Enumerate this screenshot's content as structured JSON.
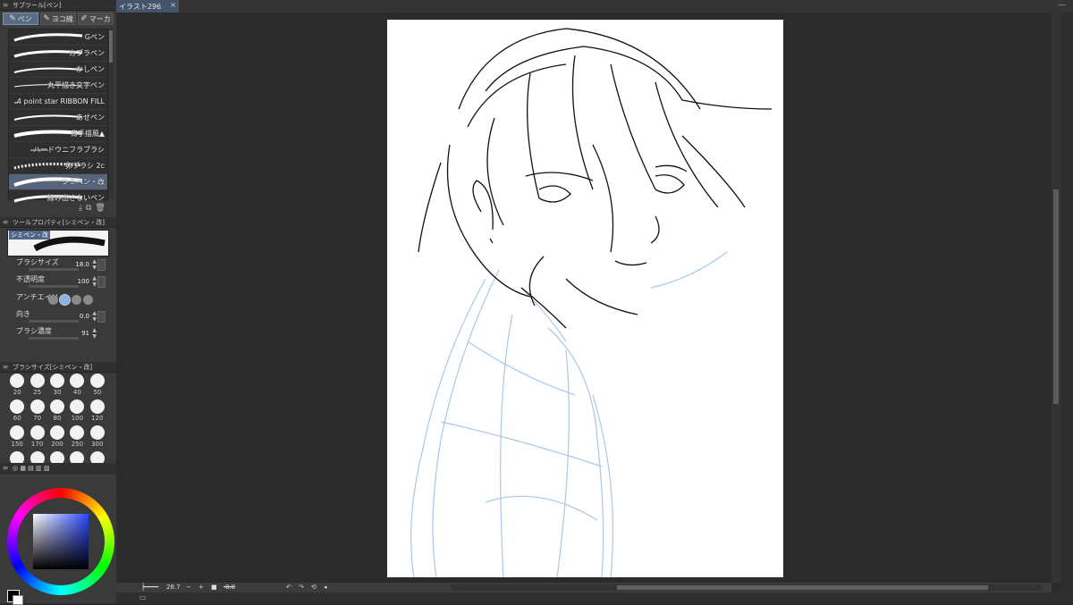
{
  "document": {
    "tab_title": "イラスト296",
    "close_glyph": "×"
  },
  "subtool_panel": {
    "title": "サブツール[ペン]",
    "tabs": [
      {
        "label": "ペン",
        "active": true
      },
      {
        "label": "ヨコ線",
        "active": false
      },
      {
        "label": "マーカ",
        "active": false
      }
    ],
    "brushes": [
      {
        "label": "Gペン",
        "selected": false
      },
      {
        "label": "カブラペン",
        "selected": false
      },
      {
        "label": "かしペン",
        "selected": false
      },
      {
        "label": "丸平描き文字ペン",
        "selected": false
      },
      {
        "label": "4 point star RIBBON FILL",
        "selected": false
      },
      {
        "label": "あせペン",
        "selected": false
      },
      {
        "label": "背手描風▲",
        "selected": false
      },
      {
        "label": "ハードウニフラブラシ",
        "selected": false
      },
      {
        "label": "卵ブラシ 2c",
        "selected": false
      },
      {
        "label": "シミペン・改",
        "selected": true
      },
      {
        "label": "線み出さないペン",
        "selected": false
      }
    ]
  },
  "tool_property": {
    "title": "ツールプロパティ[シミペン・改]",
    "preview_label": "シミペン・改",
    "brush_size": {
      "label": "ブラシサイズ",
      "value": "18.0"
    },
    "opacity": {
      "label": "不透明度",
      "value": "100"
    },
    "antialias": {
      "label": "アンチエイリ"
    },
    "direction": {
      "label": "向き",
      "value": "0.0"
    },
    "density": {
      "label": "ブラシ濃度",
      "value": "91"
    }
  },
  "brush_size_panel": {
    "title": "ブラシサイズ[シミペン・改]",
    "sizes": [
      "20",
      "25",
      "30",
      "40",
      "50",
      "60",
      "70",
      "80",
      "100",
      "120",
      "150",
      "170",
      "200",
      "250",
      "300",
      "",
      "",
      "",
      "",
      ""
    ]
  },
  "color": {
    "main": "#000000",
    "sub": "#ffffff",
    "hue": "#2a48ff"
  },
  "bottom_bar": {
    "zoom": "28.7",
    "angle": "0.0"
  }
}
